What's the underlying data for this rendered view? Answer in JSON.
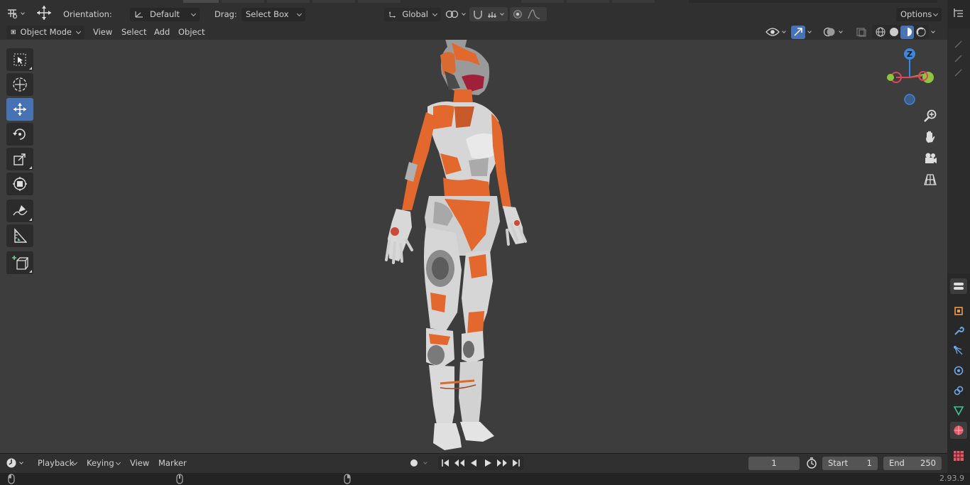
{
  "toolheader": {
    "orientation_label": "Orientation:",
    "orientation_value": "Default",
    "drag_label": "Drag:",
    "drag_value": "Select Box",
    "transform_orientation": "Global",
    "options_label": "Options"
  },
  "viewheader": {
    "mode": "Object Mode",
    "menus": [
      "View",
      "Select",
      "Add",
      "Object"
    ]
  },
  "gizmo": {
    "z_label": "Z"
  },
  "timeline": {
    "menus": [
      "Playback",
      "Keying",
      "View",
      "Marker"
    ],
    "current_frame": "1",
    "start_label": "Start",
    "start_value": "1",
    "end_label": "End",
    "end_value": "250"
  },
  "statusbar": {
    "version": "2.93.9"
  },
  "colors": {
    "accent": "#4772b3",
    "axis_x": "#e0455a",
    "axis_y": "#8cc63f",
    "axis_z": "#3d86d8",
    "suit_orange": "#e2682d",
    "suit_white": "#d8d8d8"
  },
  "icons": [
    "editor-type-icon",
    "transform-icon",
    "cursor-tool-icon",
    "select-box-icon",
    "move-icon",
    "rotate-icon",
    "scale-icon",
    "transform-all-icon",
    "annotate-icon",
    "measure-icon",
    "add-cube-icon",
    "zoom-icon",
    "hand-icon",
    "camera-icon",
    "grid-icon",
    "play-icon",
    "clock-icon"
  ]
}
